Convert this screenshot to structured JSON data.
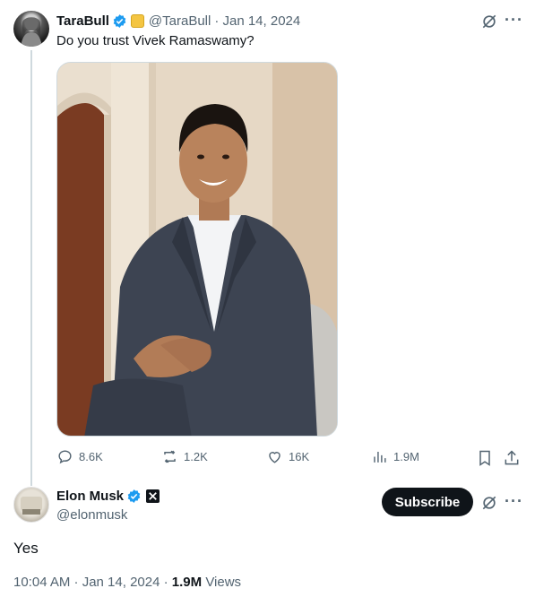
{
  "tweet": {
    "author_name": "TaraBull",
    "author_handle": "@TaraBull",
    "date": "· Jan 14, 2024",
    "text": "Do you trust Vivek Ramaswamy?",
    "stats": {
      "replies": "8.6K",
      "reposts": "1.2K",
      "likes": "16K",
      "views": "1.9M"
    }
  },
  "reply": {
    "author_name": "Elon Musk",
    "author_handle": "@elonmusk",
    "subscribe_label": "Subscribe",
    "text": "Yes",
    "timestamp": "10:04 AM · Jan 14, 2024 · ",
    "views_count": "1.9M",
    "views_label": "Views"
  },
  "colors": {
    "verified": "#1d9bf0",
    "text_primary": "#0f1419",
    "text_secondary": "#536471",
    "subscribe_bg": "#0f1419"
  },
  "icons": [
    "verified-icon",
    "gold-badge-icon",
    "grok-icon",
    "more-icon",
    "reply-icon",
    "repost-icon",
    "like-icon",
    "views-icon",
    "bookmark-icon",
    "share-icon",
    "x-logo-icon"
  ]
}
